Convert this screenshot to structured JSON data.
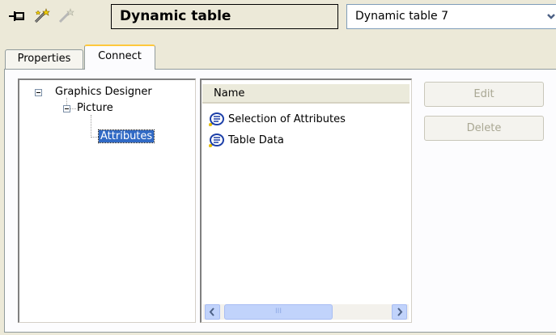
{
  "toolbar": {
    "pin_icon": "pin-icon",
    "wand_icon": "magic-wand-icon",
    "wand_disabled_icon": "magic-wand-disabled-icon",
    "object_title": "Dynamic table",
    "object_select_value": "Dynamic table 7"
  },
  "tabs": [
    {
      "label": "Properties",
      "active": false
    },
    {
      "label": "Connect",
      "active": true
    }
  ],
  "tree": {
    "root": "Graphics Designer",
    "child": "Picture",
    "leaf": "Attributes",
    "selected": "Attributes"
  },
  "list": {
    "column_header": "Name",
    "items": [
      {
        "label": "Selection of Attributes",
        "icon": "action-script-icon"
      },
      {
        "label": "Table Data",
        "icon": "action-script-icon"
      }
    ],
    "scroll_thumb_grip": "III"
  },
  "buttons": {
    "edit_label": "Edit",
    "delete_label": "Delete",
    "enabled": false
  },
  "colors": {
    "selection": "#316ac5",
    "active_tab_accent": "#ffc83c",
    "window_bg": "#ece9d8",
    "disabled_text": "#a9a793"
  }
}
